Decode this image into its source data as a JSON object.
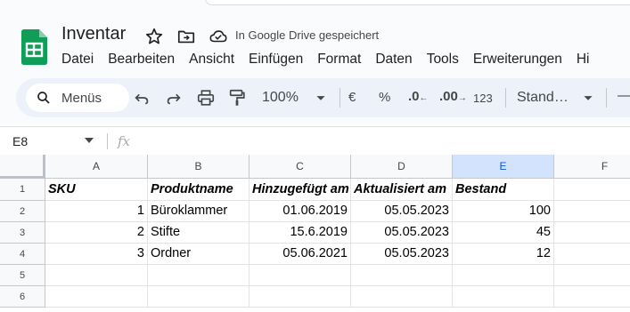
{
  "doc": {
    "title": "Inventar",
    "saved_status": "In Google Drive gespeichert"
  },
  "menubar": [
    "Datei",
    "Bearbeiten",
    "Ansicht",
    "Einfügen",
    "Format",
    "Daten",
    "Tools",
    "Erweiterungen",
    "Hi"
  ],
  "toolbar": {
    "search_label": "Menüs",
    "zoom": "100%",
    "currency": "€",
    "percent": "%",
    "decrease_decimals": ".0",
    "increase_decimals": ".00",
    "number_format": "123",
    "font": "Stand…",
    "font_size_minus": "—"
  },
  "formula_bar": {
    "cell_ref": "E8",
    "fx": "fx",
    "content": ""
  },
  "sheet": {
    "columns": [
      "A",
      "B",
      "C",
      "D",
      "E",
      "F"
    ],
    "selected_column": "E",
    "rows": [
      "1",
      "2",
      "3",
      "4",
      "5",
      "6"
    ],
    "cells": [
      [
        "SKU",
        "Produktname",
        "Hinzugefügt am",
        "Aktualisiert am",
        "Bestand",
        ""
      ],
      [
        "1",
        "Büroklammer",
        "01.06.2019",
        "05.05.2023",
        "100",
        ""
      ],
      [
        "2",
        "Stifte",
        "15.6.2019",
        "05.05.2023",
        "45",
        ""
      ],
      [
        "3",
        "Ordner",
        "05.06.2021",
        "05.05.2023",
        "12",
        ""
      ],
      [
        "",
        "",
        "",
        "",
        "",
        ""
      ],
      [
        "",
        "",
        "",
        "",
        "",
        ""
      ]
    ]
  },
  "icons": [
    "sheets-logo-icon",
    "star-icon",
    "move-to-folder-icon",
    "cloud-saved-icon",
    "search-icon",
    "undo-icon",
    "redo-icon",
    "print-icon",
    "paint-format-icon",
    "dropdown-icon"
  ],
  "colors": {
    "logo_green": "#0f9d58",
    "toolbar_bg": "#edf2fa",
    "selected_header": "#d3e3fd"
  }
}
